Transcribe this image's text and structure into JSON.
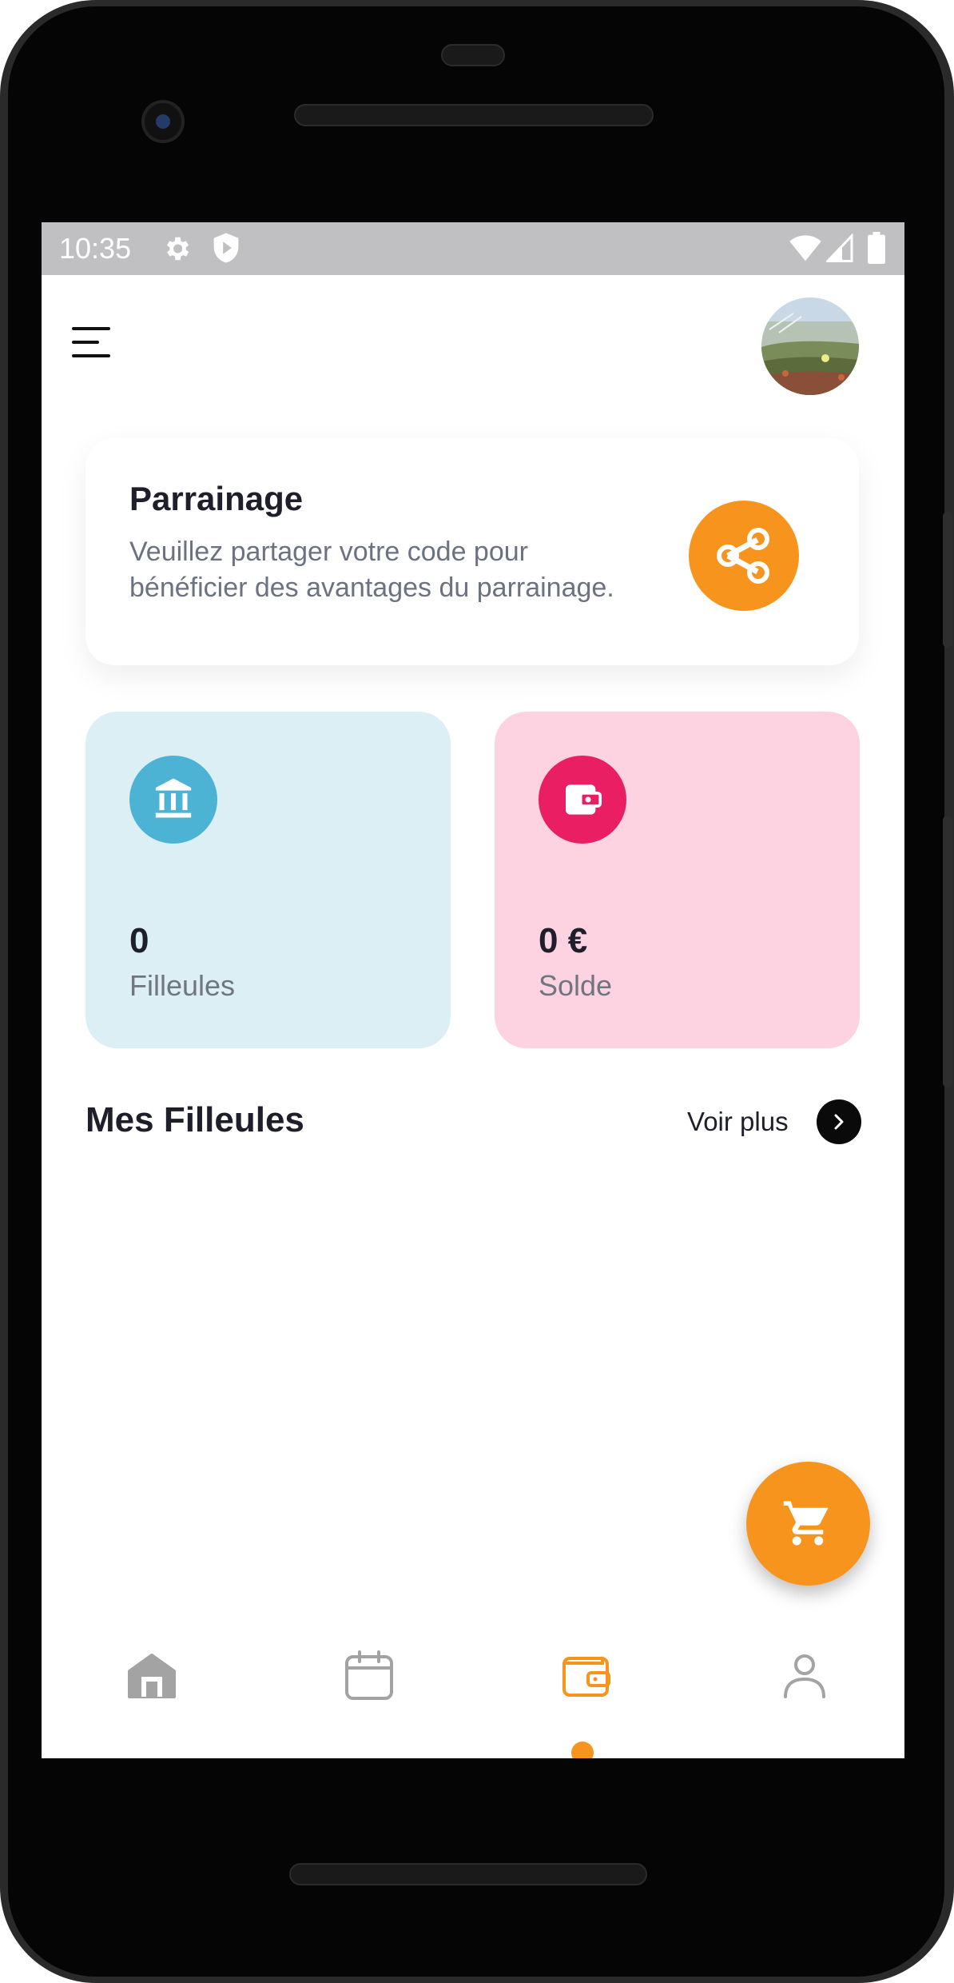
{
  "status_bar": {
    "time": "10:35",
    "icons": [
      "settings-icon",
      "shield-icon",
      "wifi-icon",
      "signal-icon",
      "battery-icon"
    ]
  },
  "header": {
    "menu_icon": "hamburger-menu-icon",
    "avatar": "profile-avatar"
  },
  "referral": {
    "title": "Parrainage",
    "description": "Veuillez partager votre code pour bénéficier des avantages du parrainage.",
    "share_icon": "share-icon"
  },
  "stats": [
    {
      "value": "0",
      "label": "Filleules",
      "icon": "bank-icon",
      "bg": "#dbeff5",
      "icon_bg": "#4cb3d4"
    },
    {
      "value": "0 €",
      "label": "Solde",
      "icon": "wallet-icon",
      "bg": "#fdd3e2",
      "icon_bg": "#ea1e63"
    }
  ],
  "section": {
    "title": "Mes Filleules",
    "see_more": "Voir plus"
  },
  "fab": {
    "icon": "cart-icon"
  },
  "bottom_nav": {
    "items": [
      {
        "name": "home",
        "icon": "home-icon",
        "active": false
      },
      {
        "name": "calendar",
        "icon": "calendar-icon",
        "active": false
      },
      {
        "name": "wallet",
        "icon": "wallet-icon",
        "active": true
      },
      {
        "name": "profile",
        "icon": "user-icon",
        "active": false
      }
    ],
    "active_color": "#f7941d",
    "inactive_color": "#a3a3a3"
  },
  "colors": {
    "accent": "#f7941d",
    "text_dark": "#1f1f2b",
    "text_muted": "#6b7280"
  }
}
